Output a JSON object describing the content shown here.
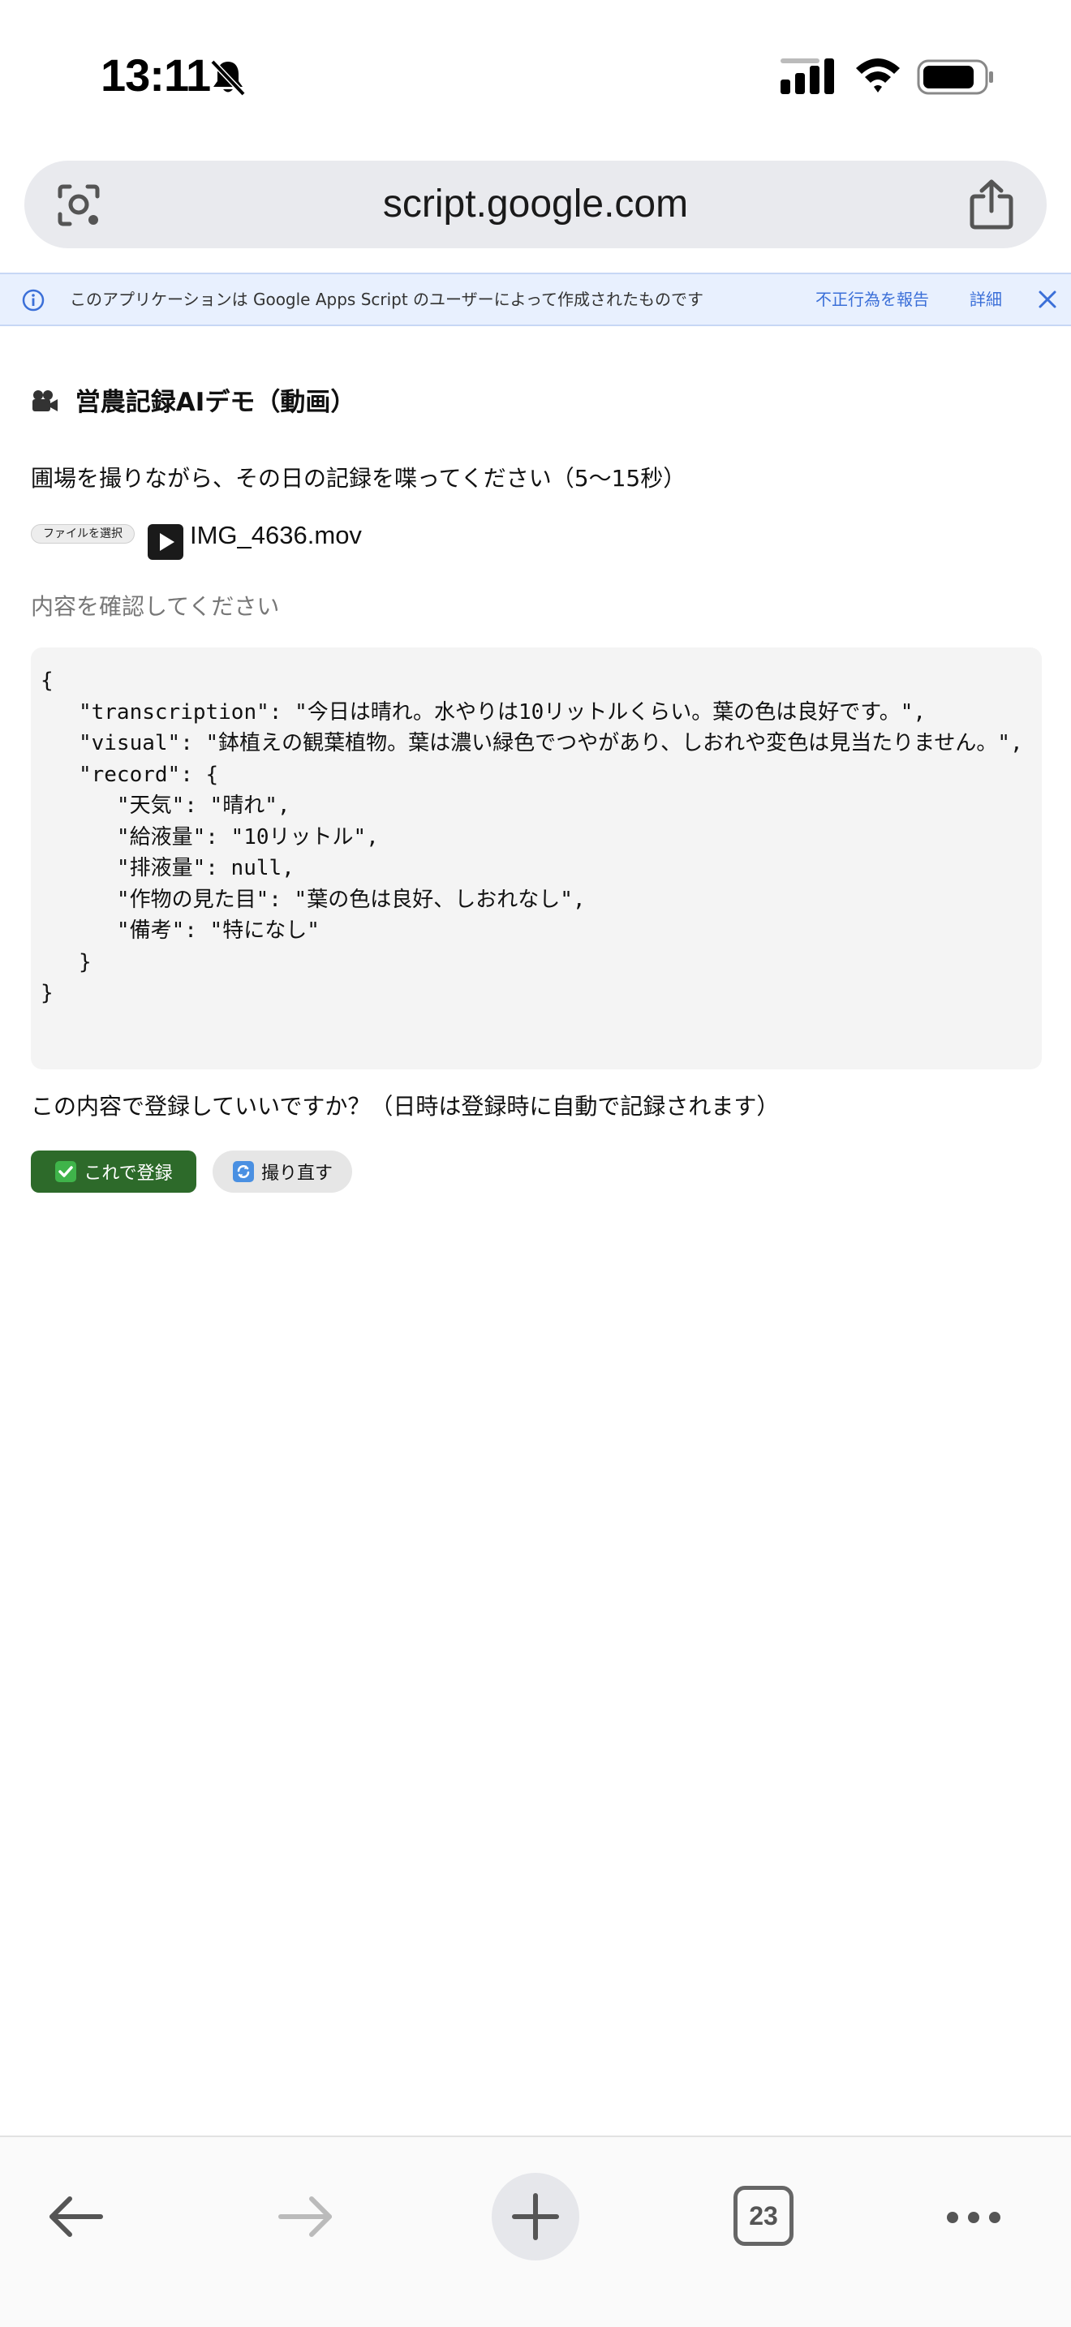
{
  "status_bar": {
    "time": "13:11"
  },
  "browser": {
    "url": "script.google.com",
    "tab_count": "23"
  },
  "banner": {
    "message": "このアプリケーションは Google Apps Script のユーザーによって作成されたものです",
    "report_link": "不正行為を報告",
    "details_link": "詳細"
  },
  "page": {
    "title": "営農記録AIデモ（動画）",
    "instructions": "圃場を撮りながら、その日の記録を喋ってください（5〜15秒）",
    "file_button_label": "ファイルを選択",
    "file_name": "IMG_4636.mov",
    "status": "内容を確認してください",
    "result_json": "{\n   \"transcription\": \"今日は晴れ。水やりは10リットルくらい。葉の色は良好です。\",\n   \"visual\": \"鉢植えの観葉植物。葉は濃い緑色でつやがあり、しおれや変色は見当たりません。\",\n   \"record\": {\n      \"天気\": \"晴れ\",\n      \"給液量\": \"10リットル\",\n      \"排液量\": null,\n      \"作物の見た目\": \"葉の色は良好、しおれなし\",\n      \"備考\": \"特になし\"\n   }\n}",
    "confirm_question": "この内容で登録していいですか？（日時は登録時に自動で記録されます）",
    "register_label": "これで登録",
    "retake_label": "撮り直す"
  },
  "colors": {
    "register_button": "#2d6a2a",
    "banner_background": "#e8f0fe",
    "link": "#3b6fd8"
  },
  "icons": {
    "title": "movie-camera-icon",
    "file": "play-icon",
    "register": "check-box-icon",
    "retake": "refresh-icon"
  }
}
